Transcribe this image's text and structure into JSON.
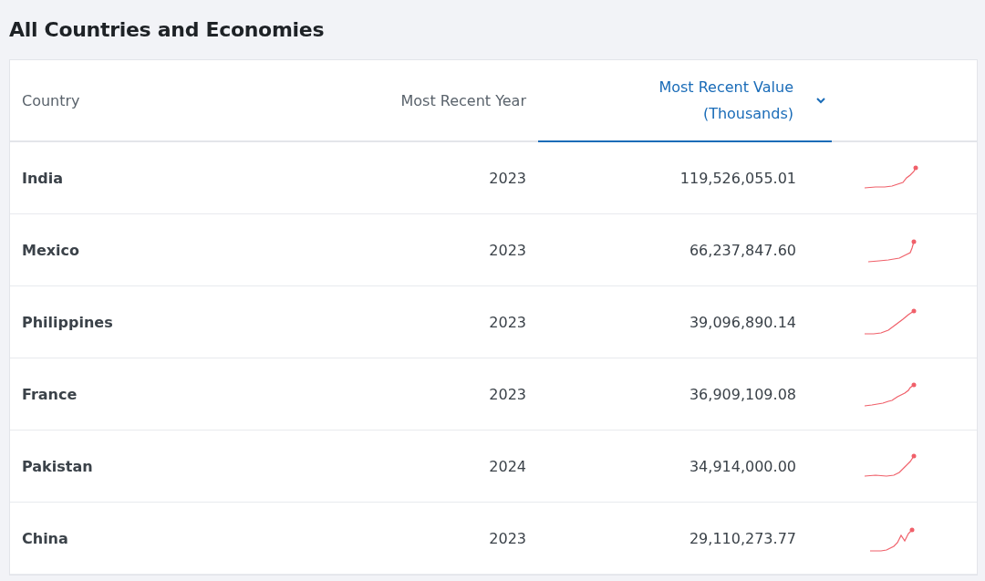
{
  "title": "All Countries and Economies",
  "table": {
    "columns": [
      {
        "label": "Country",
        "sorted": false
      },
      {
        "label": "Most Recent Year",
        "sorted": false
      },
      {
        "label": "Most Recent Value (Thousands)",
        "sorted": true
      }
    ],
    "rows": [
      {
        "country": "India",
        "year": "2023",
        "value": "119,526,055.01"
      },
      {
        "country": "Mexico",
        "year": "2023",
        "value": "66,237,847.60"
      },
      {
        "country": "Philippines",
        "year": "2023",
        "value": "39,096,890.14"
      },
      {
        "country": "France",
        "year": "2023",
        "value": "36,909,109.08"
      },
      {
        "country": "Pakistan",
        "year": "2024",
        "value": "34,914,000.00"
      },
      {
        "country": "China",
        "year": "2023",
        "value": "29,110,273.77"
      }
    ]
  }
}
